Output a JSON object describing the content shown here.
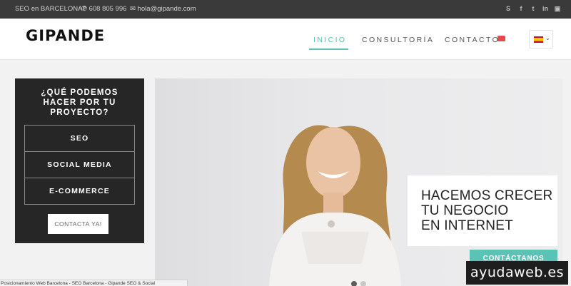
{
  "topbar": {
    "tagline": "SEO en BARCELONA?",
    "phone": "608 805 996",
    "email": "hola@gipande.com",
    "social_icons": [
      "skype-icon",
      "facebook-icon",
      "twitter-icon",
      "linkedin-icon",
      "instagram-icon"
    ]
  },
  "header": {
    "logo": "GIPANDE",
    "nav": [
      {
        "label": "INICIO",
        "active": true
      },
      {
        "label": "CONSULTORÍA",
        "active": false
      },
      {
        "label": "CONTACTO",
        "active": false
      }
    ],
    "language_flag": "spain-flag-icon"
  },
  "panel": {
    "title_line1": "¿QUÉ PODEMOS",
    "title_line2": "HACER POR TU",
    "title_line3": "PROYECTO?",
    "services": [
      "SEO",
      "SOCIAL MEDIA",
      "E-COMMERCE"
    ],
    "cta": "CONTACTA YA!"
  },
  "hero": {
    "line1": "HACEMOS CRECER",
    "line2": "TU NEGOCIO",
    "line3": "EN INTERNET",
    "cta": "CONTÁCTANOS",
    "slides_total": 2,
    "slide_active": 1
  },
  "status_bar": "Posicionamiento Web Barcelona - SEO Barcelona - Gipande SEO & Social",
  "watermark": "ayudaweb.es",
  "colors": {
    "accent": "#58c0b5",
    "topbar": "#3a3a3a",
    "panel": "#262626"
  }
}
